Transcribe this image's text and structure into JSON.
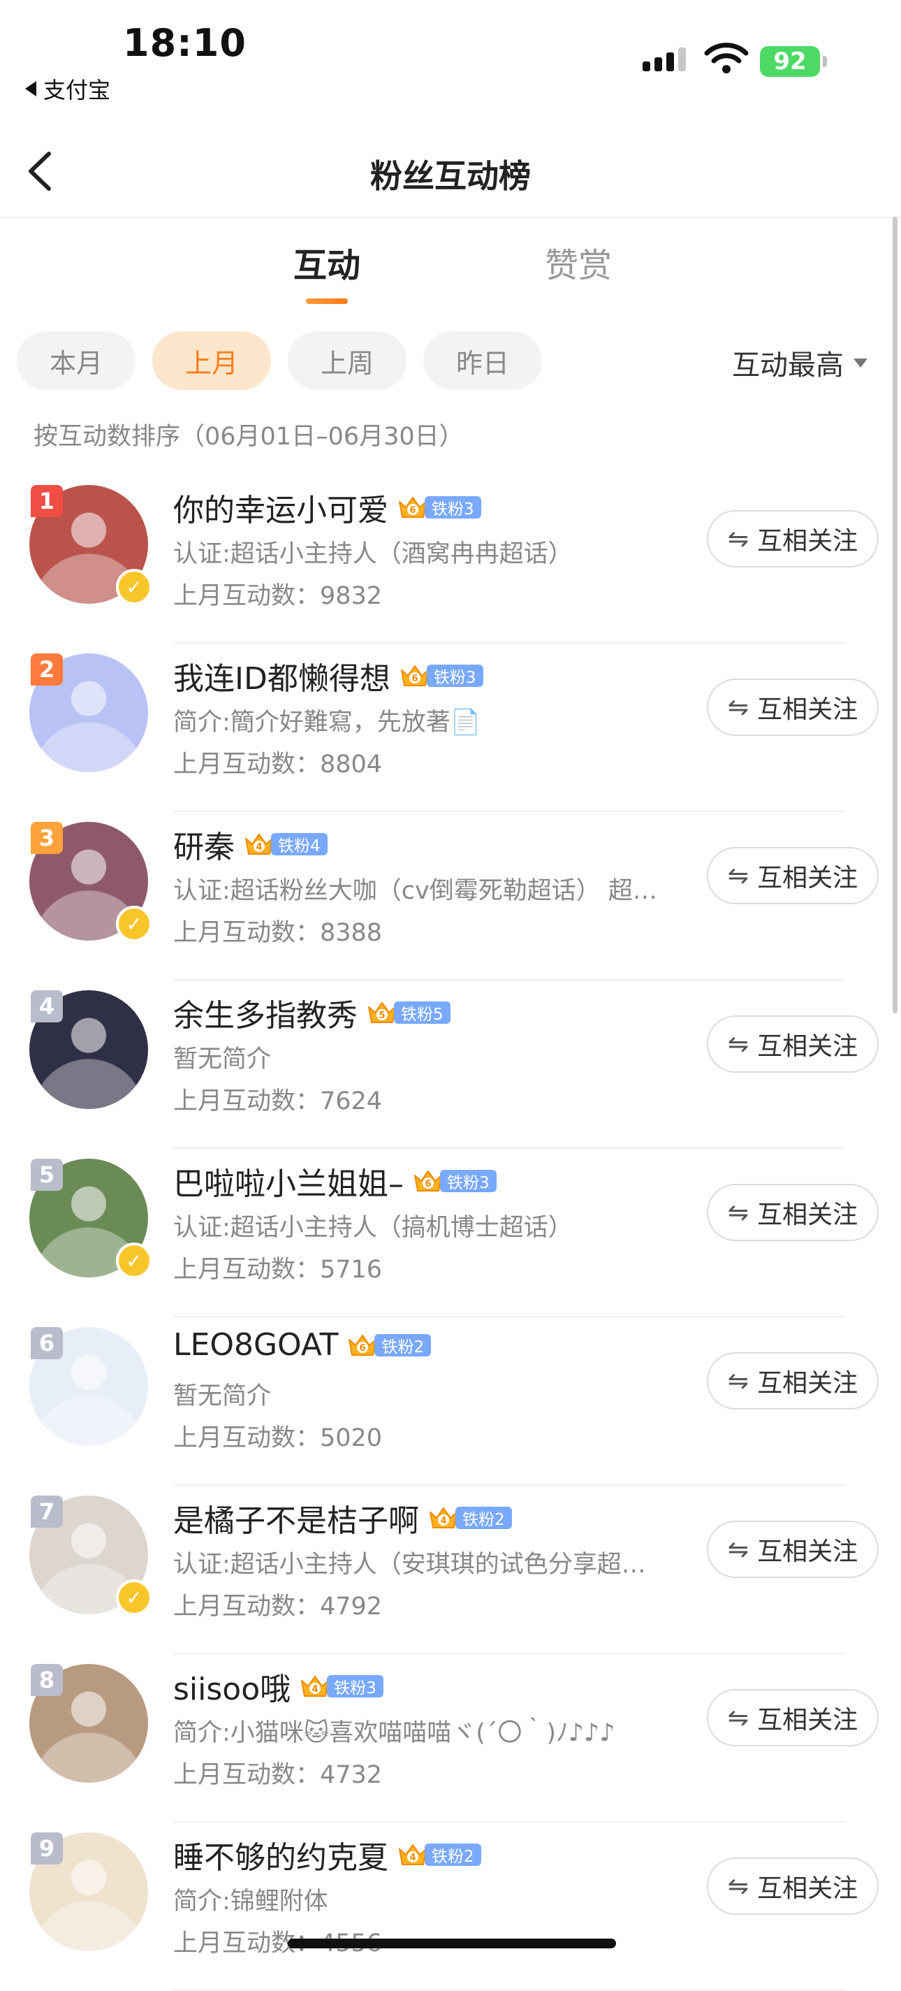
{
  "status_bar": {
    "time": "18:10",
    "back_app": "支付宝",
    "battery": "92"
  },
  "nav": {
    "title": "粉丝互动榜",
    "back_icon": "chevron-left-icon"
  },
  "tabs": [
    {
      "label": "互动",
      "active": true
    },
    {
      "label": "赞赏",
      "active": false
    }
  ],
  "periods": [
    {
      "label": "本月",
      "active": false
    },
    {
      "label": "上月",
      "active": true
    },
    {
      "label": "上周",
      "active": false
    },
    {
      "label": "昨日",
      "active": false
    }
  ],
  "sort": {
    "label": "互动最高"
  },
  "sort_hint": "按互动数排序（06月01日–06月30日）",
  "follow_label": "互相关注",
  "rank_colors": {
    "1": "#f04e45",
    "2": "#ff7a3c",
    "3": "#ffa23a",
    "other": "#b9bccb"
  },
  "fans": [
    {
      "rank": "1",
      "name": "你的幸运小可爱",
      "badge": "铁粉3",
      "crown_level": "6",
      "desc": "认证:超话小主持人（酒窝冉冉超话）",
      "count": "上月互动数：9832",
      "verified": true,
      "avatar_color": "#b9534b"
    },
    {
      "rank": "2",
      "name": "我连ID都懒得想",
      "badge": "铁粉3",
      "crown_level": "6",
      "desc": "简介:簡介好難寫，先放著📄",
      "count": "上月互动数：8804",
      "verified": false,
      "avatar_color": "#b9c2f5"
    },
    {
      "rank": "3",
      "name": "研秦",
      "badge": "铁粉4",
      "crown_level": "4",
      "desc": "认证:超话粉丝大咖（cv倒霉死勒超话） 超…",
      "count": "上月互动数：8388",
      "verified": true,
      "avatar_color": "#8e5a6a"
    },
    {
      "rank": "4",
      "name": "余生多指教秀",
      "badge": "铁粉5",
      "crown_level": "5",
      "desc": "暂无简介",
      "count": "上月互动数：7624",
      "verified": false,
      "avatar_color": "#2f2f46"
    },
    {
      "rank": "5",
      "name": "巴啦啦小兰姐姐–",
      "badge": "铁粉3",
      "crown_level": "6",
      "desc": "认证:超话小主持人（搞机博士超话）",
      "count": "上月互动数：5716",
      "verified": true,
      "avatar_color": "#6a8a56"
    },
    {
      "rank": "6",
      "name": "LEO8GOAT",
      "badge": "铁粉2",
      "crown_level": "6",
      "desc": "暂无简介",
      "count": "上月互动数：5020",
      "verified": false,
      "avatar_color": "#e8eef7"
    },
    {
      "rank": "7",
      "name": "是橘子不是桔子啊",
      "badge": "铁粉2",
      "crown_level": "4",
      "desc": "认证:超话小主持人（安琪琪的试色分享超…",
      "count": "上月互动数：4792",
      "verified": true,
      "avatar_color": "#dcd6cf"
    },
    {
      "rank": "8",
      "name": "siisoo哦",
      "badge": "铁粉3",
      "crown_level": "4",
      "desc": "简介:小猫咪🐱喜欢喵喵喵ヾ(´〇｀)ﾉ♪♪♪",
      "count": "上月互动数：4732",
      "verified": false,
      "avatar_color": "#b89a80"
    },
    {
      "rank": "9",
      "name": "睡不够的约克夏",
      "badge": "铁粉2",
      "crown_level": "4",
      "desc": "简介:锦鲤附体",
      "count": "上月互动数：4556",
      "verified": false,
      "avatar_color": "#efe2cf"
    }
  ]
}
